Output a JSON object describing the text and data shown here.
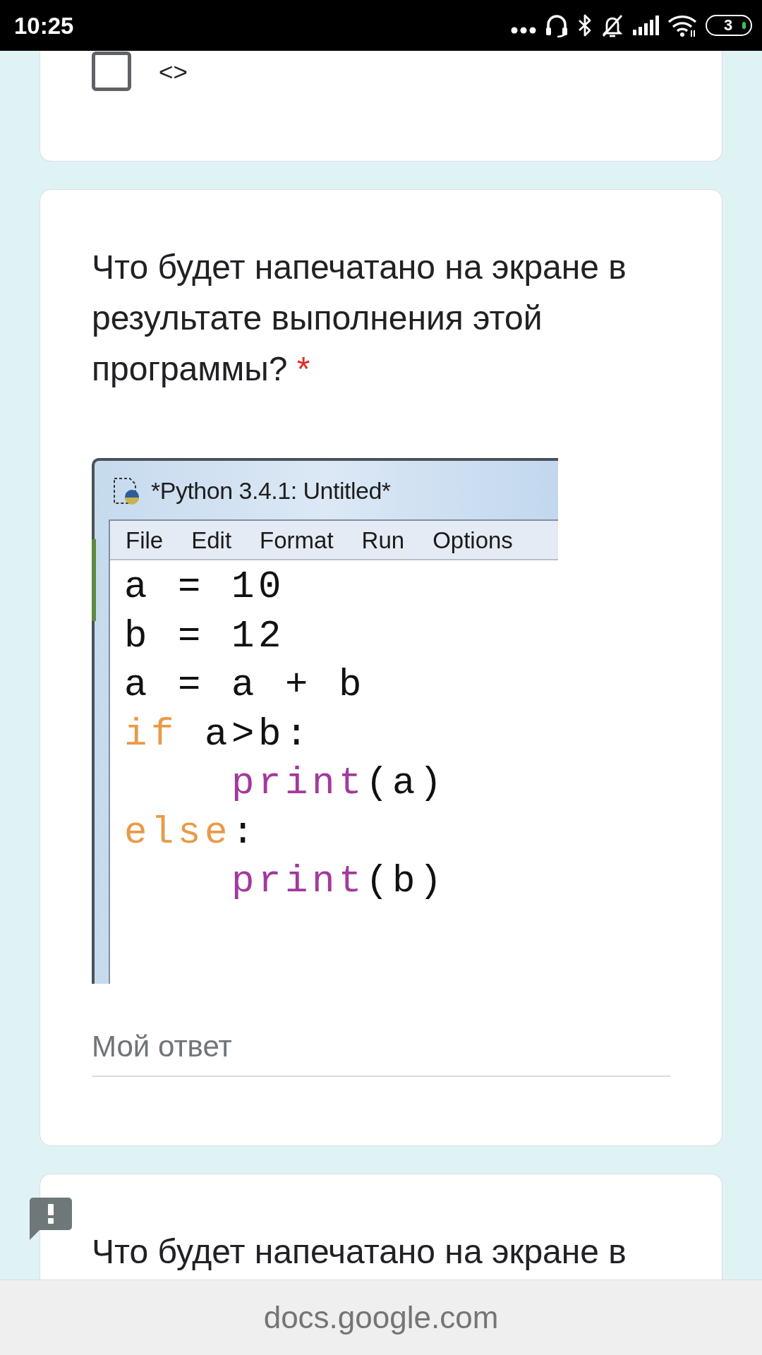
{
  "status_bar": {
    "time": "10:25",
    "battery_text": "3"
  },
  "cards": [
    {
      "kind": "options",
      "options": [
        {
          "label": "<>",
          "checked": false
        }
      ]
    },
    {
      "kind": "question",
      "text": "Что будет напечатано на экране в результате выполнения этой программы?",
      "required_mark": "*",
      "image": {
        "window_title": "*Python 3.4.1: Untitled*",
        "menu": [
          "File",
          "Edit",
          "Format",
          "Run",
          "Options"
        ],
        "code": [
          {
            "tokens": [
              {
                "kind": "plain",
                "text": "a = 10"
              }
            ]
          },
          {
            "tokens": [
              {
                "kind": "plain",
                "text": "b = 12"
              }
            ]
          },
          {
            "tokens": [
              {
                "kind": "plain",
                "text": "a = a + b"
              }
            ]
          },
          {
            "tokens": [
              {
                "kind": "keyword",
                "text": "if"
              },
              {
                "kind": "plain",
                "text": " a>b:"
              }
            ],
            "children": [
              {
                "tokens": [
                  {
                    "kind": "builtin",
                    "text": "print"
                  },
                  {
                    "kind": "plain",
                    "text": "(a)"
                  }
                ]
              }
            ]
          },
          {
            "tokens": [
              {
                "kind": "keyword",
                "text": "else"
              },
              {
                "kind": "plain",
                "text": ":"
              }
            ],
            "children": [
              {
                "tokens": [
                  {
                    "kind": "builtin",
                    "text": "print"
                  },
                  {
                    "kind": "plain",
                    "text": "(b)"
                  }
                ]
              }
            ]
          }
        ]
      },
      "answer": {
        "placeholder": "Мой ответ"
      }
    },
    {
      "kind": "question",
      "alert": true,
      "text": "Что будет напечатано на экране в"
    }
  ],
  "address_bar": {
    "url": "docs.google.com"
  }
}
